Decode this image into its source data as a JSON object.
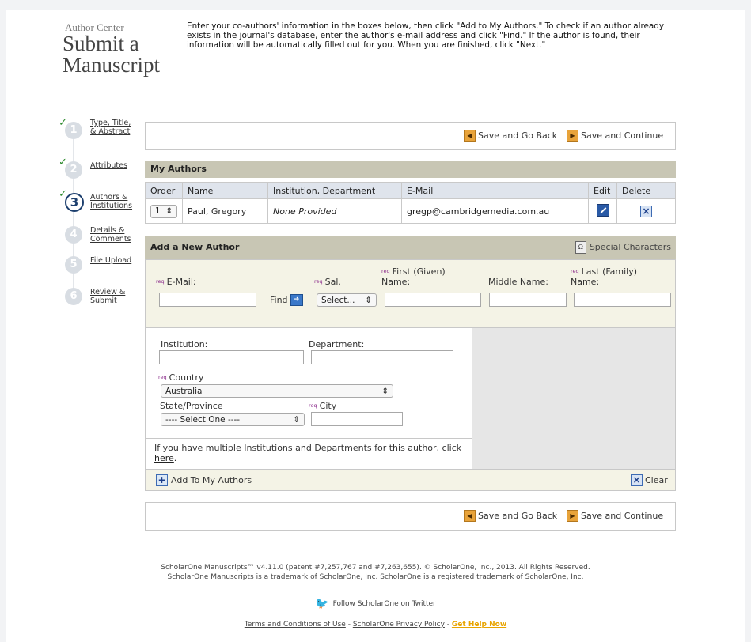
{
  "header": {
    "subtitle": "Author Center",
    "title_line1": "Submit a",
    "title_line2": "Manuscript",
    "instructions": "Enter your co-authors' information in the boxes below, then click \"Add to My Authors.\" To check if an author already exists in the journal's database, enter the author's e-mail address and click \"Find.\" If the author is found, their information will be automatically filled out for you. When you are finished, click \"Next.\""
  },
  "steps": [
    {
      "number": "1",
      "label": "Type, Title, & Abstract",
      "complete": true
    },
    {
      "number": "2",
      "label": "Attributes",
      "complete": true
    },
    {
      "number": "3",
      "label": "Authors & Institutions",
      "complete": true,
      "active": true
    },
    {
      "number": "4",
      "label": "Details & Comments",
      "complete": false
    },
    {
      "number": "5",
      "label": "File Upload",
      "complete": false
    },
    {
      "number": "6",
      "label": "Review & Submit",
      "complete": false
    }
  ],
  "nav": {
    "save_back": "Save and Go Back",
    "save_continue": "Save and Continue"
  },
  "my_authors": {
    "heading": "My Authors",
    "columns": [
      "Order",
      "Name",
      "Institution, Department",
      "E-Mail",
      "Edit",
      "Delete"
    ],
    "rows": [
      {
        "order": "1",
        "name": "Paul, Gregory",
        "institution": "None Provided",
        "email": "gregp@cambridgemedia.com.au"
      }
    ]
  },
  "add_author": {
    "heading": "Add a New Author",
    "special_chars": "Special Characters",
    "req_tag": "req",
    "email_label": "E-Mail:",
    "find_label": "Find",
    "sal_label": "Sal.",
    "sal_value": "Select...",
    "first_label": "First (Given) Name:",
    "middle_label": "Middle Name:",
    "last_label": "Last (Family) Name:",
    "institution_label": "Institution:",
    "department_label": "Department:",
    "country_label": "Country",
    "country_value": "Australia",
    "state_label": "State/Province",
    "state_value": "---- Select One ----",
    "city_label": "City",
    "multi_text": "If you have multiple Institutions and Departments for this author, click",
    "multi_link": "here",
    "add_button": "Add To My Authors",
    "clear_button": "Clear"
  },
  "footer": {
    "copyright1": "ScholarOne Manuscripts™ v4.11.0 (patent #7,257,767 and #7,263,655). © ScholarOne, Inc., 2013. All Rights Reserved.",
    "copyright2": "ScholarOne Manuscripts is a trademark of ScholarOne, Inc. ScholarOne is a registered trademark of ScholarOne, Inc.",
    "twitter": "Follow ScholarOne on Twitter",
    "terms": "Terms and Conditions of Use",
    "privacy": "ScholarOne Privacy Policy",
    "help": "Get Help Now",
    "help_color": "#e8a400"
  }
}
